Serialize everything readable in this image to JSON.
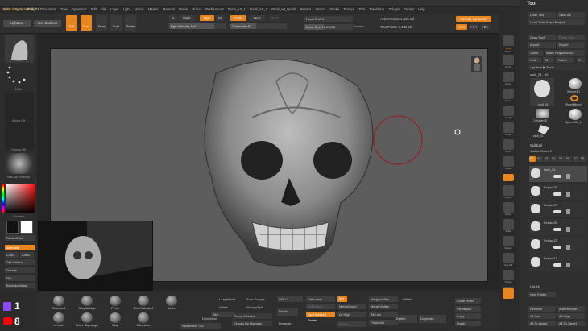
{
  "menu": [
    "Alpha",
    "Brush",
    "Color",
    "Document",
    "Draw",
    "Dynamics",
    "Edit",
    "File",
    "Layer",
    "Light",
    "Macro",
    "Marker",
    "Material",
    "Movie",
    "Picker",
    "Preferences",
    "Punk_Art_1",
    "Punk_Art_2",
    "Punk_art_Brush",
    "Render",
    "Stencil",
    "Stroke",
    "Texture",
    "Tool",
    "Transform",
    "Zplugin",
    "Zscript",
    "Help"
  ],
  "status": {
    "message": "Switching to Subtool 1",
    "tool": "skull_01"
  },
  "shelf": {
    "lightbox": "LightBox",
    "live_boolean": "Live Boolean",
    "edit": "Edit",
    "draw": "Draw",
    "move": "Move",
    "scale": "Scale",
    "rotate": "Rotate",
    "a": "A",
    "mrgb": "Mrgb",
    "rgb": "Rgb",
    "m": "M",
    "zadd": "Zadd",
    "zsub": "Zsub",
    "zcut": "Zcut",
    "rgb_intensity": "Rgb Intensity 100",
    "z_intensity": "Z Intensity 52",
    "focal_shift": "Focal Shift 0",
    "draw_size": "Draw Size 77.63378",
    "dynamic": "Dynamic",
    "active_points": "ActivePoints: 1.195 Mil",
    "total_points": "TotalPoints: 3.432 Mil",
    "activate_symmetry": "Activate Symmetry",
    ">x<": ">X<",
    ">y<": ">Y<",
    ">z<": ">Z<"
  },
  "left": {
    "brush_label": "Move",
    "stroke_label": "Dots",
    "alpha_label": "Alpha Off",
    "texture_label": "Texture Off",
    "material_label": "MatCap Material",
    "gradient": "Gradient",
    "switch_color": "SwitchColor",
    "alternate": "Alternate",
    "cust1": "Cust1",
    "cust2": "Cust2",
    "del_hidden": "Del Hidden",
    "double": "Double",
    "flip": "Flip",
    "backface": "BackfaceMask"
  },
  "rshelf": [
    "BPR",
    "SPix 3",
    "Scroll",
    "Zoom",
    "Actual",
    "AAHalf",
    "Dynamic",
    "Persp",
    "Floor",
    "Local",
    "Frame",
    "Move",
    "Scale",
    "Rotate",
    "Line Fill",
    "PolyF",
    "Transp",
    "Solo",
    "Xpose"
  ],
  "toolpanel": {
    "title": "Tool",
    "load_tool": "Load Tool",
    "save_as": "Save As",
    "load_tools_project": "Load Tools From Project",
    "copy_tool": "Copy Tool",
    "paste_tool": "Paste Tool",
    "import": "Import",
    "export": "Export",
    "clone": "Clone",
    "make_polymesh": "Make PolyMesh3D",
    "goz": "GoZ",
    "all": "All",
    "visible": "Visible",
    "r": "R",
    "lightbox_tools": "Lightbox ▶ Tools",
    "skull_count": "skull_01 . 49",
    "tools": [
      "skull_01",
      "Sphere3D",
      "SimpleBrush",
      "Cylinder3D",
      "skull_01",
      "PolyMesh3D_1",
      "Sphere3D_1"
    ],
    "subtool_title": "Subtool",
    "visible_count": "Visible Count 8",
    "v_tabs": [
      "V1",
      "V2",
      "V3",
      "V4",
      "V5",
      "V6",
      "V7",
      "V8"
    ],
    "subtools": [
      "skull_01",
      "Extract26",
      "Extract27",
      "Extract25",
      "Extract23",
      "Extract17"
    ],
    "list_all": "List All",
    "new_folder": "New Folder",
    "rename": "Rename",
    "autoreorder": "AutoReorder",
    "all_low": "All Low",
    "all_high": "All High",
    "all_to_home": "All To Home",
    "all_to_target": "All To Target"
  },
  "bottom": {
    "brushes": [
      "Standard",
      "ClayBuildup",
      "Pinch",
      "DamStandard",
      "Move",
      "Inflat",
      "hPolish",
      "Move Topologic",
      "Clay",
      "ZModeler"
    ],
    "lazymouse": "LazyMouse",
    "auto_groups": "Auto Groups",
    "sdiv": "SDiv 2",
    "del_lower": "Del Lower",
    "smt": "Smt",
    "inflate": "Inflate",
    "groups_split": "GroupsSplit",
    "del_higher": "Del Higher",
    "merge_down": "MergeDown",
    "merge_visible": "MergeVisible",
    "group_masked": "Group Masked",
    "dynamic": "Dynamic",
    "close_holes": "Close Holes",
    "viewmask": "ViewMask",
    "copy": "Copy",
    "paste": "Paste",
    "blur": "Blur",
    "groups": "Groups",
    "dynamesh": "DynaMesh",
    "resolution": "Resolution 780",
    "groups_by_normals": "Groups By Normals",
    "all_high": "All High",
    "all_low": "All Low",
    "delete": "Delete",
    "duplicate": "Duplicate",
    "project_all": "ProjectAll",
    "divide": "Divide",
    "split_masked": "Split Masked Points",
    "polish": "Polish"
  },
  "social": {
    "twitch_count": "1",
    "youtube_count": "8"
  },
  "colors": {
    "accent": "#e8851f",
    "canvas": "#5d5d5d",
    "panel": "#2f2f2f",
    "brush_circle": "#a0151c",
    "twitch": "#9146ff",
    "youtube": "#ff0000"
  }
}
